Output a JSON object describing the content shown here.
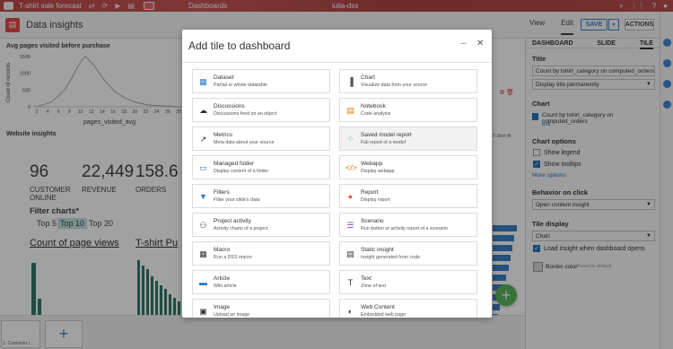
{
  "topnav": {
    "project": "T-shirt sale forecast",
    "section": "Dashboards",
    "user": "iulia-dss"
  },
  "header": {
    "title": "Data insights",
    "view_label": "View",
    "edit_label": "Edit",
    "save_label": "SAVE",
    "actions_label": "ACTIONS"
  },
  "canvas": {
    "tile_a_title": "Avg pages visited before purchase",
    "chart_a": {
      "ylabel": "Count of records",
      "xlabel": "pages_visited_avg",
      "yticks": [
        "1500",
        "1000",
        "500",
        "0"
      ],
      "xticks": [
        "2",
        "4",
        "6",
        "8",
        "10",
        "12",
        "14",
        "16",
        "18",
        "20",
        "22",
        "24",
        "26",
        "28"
      ]
    },
    "tile_b_title": "Website insights",
    "kpis": [
      {
        "value": "96",
        "label": "CUSTOMER ONLINE"
      },
      {
        "value": "22,449",
        "label": "REVENUE"
      },
      {
        "value": "158.6",
        "label": "ORDERS"
      }
    ],
    "filter_title": "Filter charts*",
    "filter_tabs": [
      "Top 5",
      "Top 10",
      "Top 20"
    ],
    "bottom_left_title": "Count of page views",
    "bottom_mid_title": "T-shirt Pu",
    "right_fragment": "T-Shirt M",
    "thumb_caption": "1. Customer i..."
  },
  "modal": {
    "title": "Add tile to dashboard",
    "options": [
      {
        "title": "Dataset",
        "desc": "Partial or whole datatable",
        "icon": "dataset-icon",
        "color": "#2a75c0",
        "glyph": "▦"
      },
      {
        "title": "Chart",
        "desc": "Visualize data from your source",
        "icon": "chart-icon",
        "color": "#555555",
        "glyph": "▐"
      },
      {
        "title": "Discussions",
        "desc": "Discussions feed on an object",
        "icon": "discussions-icon",
        "color": "#333333",
        "glyph": "☁"
      },
      {
        "title": "Notebook",
        "desc": "Code analysis",
        "icon": "notebook-icon",
        "color": "#e07b00",
        "glyph": "▤"
      },
      {
        "title": "Metrics",
        "desc": "Meta data about your source",
        "icon": "metrics-icon",
        "color": "#333333",
        "glyph": "↗"
      },
      {
        "title": "Saved model report",
        "desc": "Full report of a model",
        "icon": "saved-model-icon",
        "color": "#3b9b4c",
        "glyph": "⁘"
      },
      {
        "title": "Managed folder",
        "desc": "Display content of a folder",
        "icon": "folder-icon",
        "color": "#2a75c0",
        "glyph": "▭"
      },
      {
        "title": "Webapp",
        "desc": "Display webapp",
        "icon": "webapp-icon",
        "color": "#e07b00",
        "glyph": "</>"
      },
      {
        "title": "Filters",
        "desc": "Filter your slide's data",
        "icon": "filters-icon",
        "color": "#2a75c0",
        "glyph": "▼"
      },
      {
        "title": "Report",
        "desc": "Display report",
        "icon": "report-icon",
        "color": "#e06030",
        "glyph": "●"
      },
      {
        "title": "Project activity",
        "desc": "Activity charts of a project",
        "icon": "project-activity-icon",
        "color": "#333333",
        "glyph": "⚇"
      },
      {
        "title": "Scenario",
        "desc": "Run button or activity report of a scenario",
        "icon": "scenario-icon",
        "color": "#7a4bb3",
        "glyph": "☰"
      },
      {
        "title": "Macro",
        "desc": "Run a DSS macro",
        "icon": "macro-icon",
        "color": "#333333",
        "glyph": "▦"
      },
      {
        "title": "Static insight",
        "desc": "Insight generated from code",
        "icon": "static-insight-icon",
        "color": "#333333",
        "glyph": "▤"
      },
      {
        "title": "Article",
        "desc": "Wiki article",
        "icon": "article-icon",
        "color": "#2a75c0",
        "glyph": "▬"
      },
      {
        "title": "Text",
        "desc": "Zone of text",
        "icon": "text-icon",
        "color": "#333333",
        "glyph": "T"
      },
      {
        "title": "Image",
        "desc": "Upload an image",
        "icon": "image-icon",
        "color": "#333333",
        "glyph": "▣"
      },
      {
        "title": "Web Content",
        "desc": "Embedded web page",
        "icon": "web-content-icon",
        "color": "#333333",
        "glyph": "◐"
      }
    ]
  },
  "rpanel": {
    "tabs": [
      "DASHBOARD",
      "SLIDE",
      "TILE"
    ],
    "title_section": "Title",
    "title_value": "Count by tshirt_category on computed_orders",
    "title_mode": "Display title permanently",
    "chart_section": "Chart",
    "chart_ref": "Count by tshirt_category on computed_orders",
    "chart_edit": "edit",
    "chart_options_section": "Chart options",
    "show_legend": "Show legend",
    "show_tooltips": "Show tooltips",
    "more_options": "More options",
    "behavior_section": "Behavior on click",
    "behavior_value": "Open content insight",
    "tile_display_section": "Tile display",
    "tile_display_value": "Chart",
    "load_insight": "Load insight when dashboard opens",
    "border_color": "Border color",
    "border_reset": "Reset to default"
  }
}
